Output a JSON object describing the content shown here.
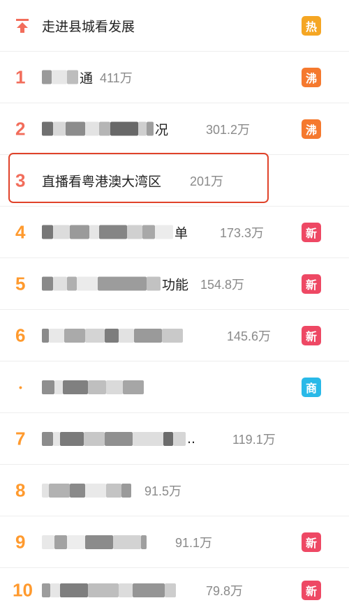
{
  "pinned": {
    "title": "走进县城看发展",
    "badge": "热",
    "badge_color": "#f5a623",
    "icon": "pin-up-arrow-icon"
  },
  "items": [
    {
      "rank": "1",
      "title_prefix": "",
      "title_suffix": "通",
      "heat": "411万",
      "badge": "沸",
      "badge_color": "#f5792e"
    },
    {
      "rank": "2",
      "title_prefix": "",
      "title_suffix": "况",
      "heat": "301.2万",
      "badge": "沸",
      "badge_color": "#f5792e"
    },
    {
      "rank": "3",
      "title": "直播看粤港澳大湾区",
      "heat": "201万",
      "badge": "",
      "badge_color": ""
    },
    {
      "rank": "4",
      "title_prefix": "",
      "title_suffix": "单",
      "heat": "173.3万",
      "badge": "新",
      "badge_color": "#ee4864"
    },
    {
      "rank": "5",
      "title_prefix": "",
      "title_suffix": "功能",
      "heat": "154.8万",
      "badge": "新",
      "badge_color": "#ee4864"
    },
    {
      "rank": "6",
      "title_prefix": "",
      "title_suffix": "",
      "heat": "145.6万",
      "badge": "新",
      "badge_color": "#ee4864"
    },
    {
      "rank": "•",
      "title_prefix": "",
      "title_suffix": "",
      "heat": "",
      "badge": "商",
      "badge_color": "#29b9e8"
    },
    {
      "rank": "7",
      "title_prefix": "",
      "title_suffix": "..",
      "heat": "119.1万",
      "badge": "",
      "badge_color": ""
    },
    {
      "rank": "8",
      "title_prefix": "",
      "title_suffix": "",
      "heat": "91.5万",
      "badge": "",
      "badge_color": ""
    },
    {
      "rank": "9",
      "title_prefix": "",
      "title_suffix": "",
      "heat": "91.1万",
      "badge": "新",
      "badge_color": "#ee4864"
    },
    {
      "rank": "10",
      "title_prefix": "",
      "title_suffix": "",
      "heat": "79.8万",
      "badge": "新",
      "badge_color": "#ee4864"
    }
  ]
}
